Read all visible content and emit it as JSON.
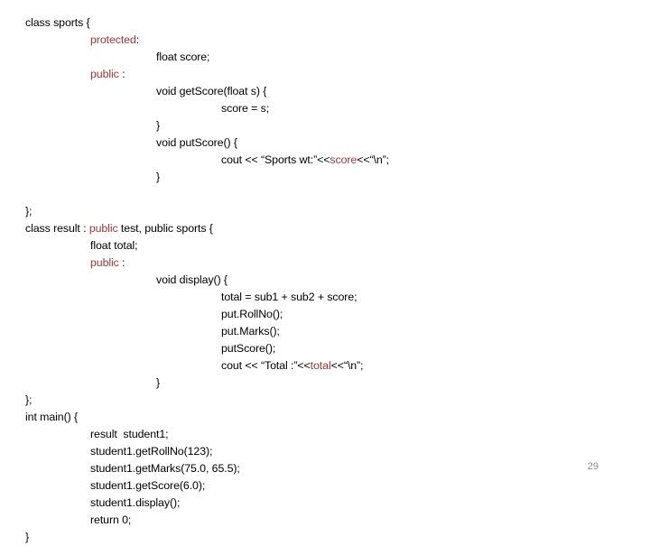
{
  "slide": {
    "page_number": "29",
    "keyword_color": "#A33639",
    "text_color": "#000000",
    "background_color": "#FFFFFF",
    "page_number_color": "#898989"
  },
  "code": {
    "lines": [
      {
        "indent": 0,
        "segments": [
          {
            "text": "class sports {",
            "kind": "plain"
          }
        ]
      },
      {
        "indent": 1,
        "segments": [
          {
            "text": "protected",
            "kind": "keyword"
          },
          {
            "text": ":",
            "kind": "plain"
          }
        ]
      },
      {
        "indent": 2,
        "segments": [
          {
            "text": "float score;",
            "kind": "plain"
          }
        ]
      },
      {
        "indent": 1,
        "segments": [
          {
            "text": "public",
            "kind": "keyword"
          },
          {
            "text": " :",
            "kind": "plain"
          }
        ]
      },
      {
        "indent": 2,
        "segments": [
          {
            "text": "void getScore(float s) {",
            "kind": "plain"
          }
        ]
      },
      {
        "indent": 3,
        "segments": [
          {
            "text": "score = s;",
            "kind": "plain"
          }
        ]
      },
      {
        "indent": 2,
        "segments": [
          {
            "text": "}",
            "kind": "plain"
          }
        ]
      },
      {
        "indent": 2,
        "segments": [
          {
            "text": "void putScore() {",
            "kind": "plain"
          }
        ]
      },
      {
        "indent": 3,
        "segments": [
          {
            "text": "cout << “Sports wt:”<<",
            "kind": "plain"
          },
          {
            "text": "score",
            "kind": "keyword"
          },
          {
            "text": "<<“\\n”;",
            "kind": "plain"
          }
        ]
      },
      {
        "indent": 2,
        "segments": [
          {
            "text": "}",
            "kind": "plain"
          }
        ]
      },
      {
        "indent": 0,
        "segments": []
      },
      {
        "indent": 0,
        "segments": [
          {
            "text": "};",
            "kind": "plain"
          }
        ]
      },
      {
        "indent": 0,
        "segments": [
          {
            "text": "class result : ",
            "kind": "plain"
          },
          {
            "text": "public",
            "kind": "keyword"
          },
          {
            "text": " test, public sports {",
            "kind": "plain"
          }
        ]
      },
      {
        "indent": 1,
        "segments": [
          {
            "text": "float total;",
            "kind": "plain"
          }
        ]
      },
      {
        "indent": 1,
        "segments": [
          {
            "text": "public",
            "kind": "keyword"
          },
          {
            "text": " :",
            "kind": "plain"
          }
        ]
      },
      {
        "indent": 2,
        "segments": [
          {
            "text": "void display() {",
            "kind": "plain"
          }
        ]
      },
      {
        "indent": 3,
        "segments": [
          {
            "text": "total = sub1 + sub2 + score;",
            "kind": "plain"
          }
        ]
      },
      {
        "indent": 3,
        "segments": [
          {
            "text": "put.RollNo();",
            "kind": "plain"
          }
        ]
      },
      {
        "indent": 3,
        "segments": [
          {
            "text": "put.Marks();",
            "kind": "plain"
          }
        ]
      },
      {
        "indent": 3,
        "segments": [
          {
            "text": "putScore();",
            "kind": "plain"
          }
        ]
      },
      {
        "indent": 3,
        "segments": [
          {
            "text": "cout << “Total :”<<",
            "kind": "plain"
          },
          {
            "text": "total",
            "kind": "keyword"
          },
          {
            "text": "<<“\\n”;",
            "kind": "plain"
          }
        ]
      },
      {
        "indent": 2,
        "segments": [
          {
            "text": "}",
            "kind": "plain"
          }
        ]
      },
      {
        "indent": 0,
        "segments": [
          {
            "text": "};",
            "kind": "plain"
          }
        ]
      },
      {
        "indent": 0,
        "segments": [
          {
            "text": "int main() {",
            "kind": "plain"
          }
        ]
      },
      {
        "indent": 1,
        "segments": [
          {
            "text": "result  student1;",
            "kind": "plain"
          }
        ]
      },
      {
        "indent": 1,
        "segments": [
          {
            "text": "student1.getRollNo(123);",
            "kind": "plain"
          }
        ]
      },
      {
        "indent": 1,
        "segments": [
          {
            "text": "student1.getMarks(75.0, 65.5);",
            "kind": "plain"
          }
        ]
      },
      {
        "indent": 1,
        "segments": [
          {
            "text": "student1.getScore(6.0);",
            "kind": "plain"
          }
        ]
      },
      {
        "indent": 1,
        "segments": [
          {
            "text": "student1.display();",
            "kind": "plain"
          }
        ]
      },
      {
        "indent": 1,
        "segments": [
          {
            "text": "return 0;",
            "kind": "plain"
          }
        ]
      },
      {
        "indent": 0,
        "segments": [
          {
            "text": "}",
            "kind": "plain"
          }
        ]
      }
    ]
  }
}
